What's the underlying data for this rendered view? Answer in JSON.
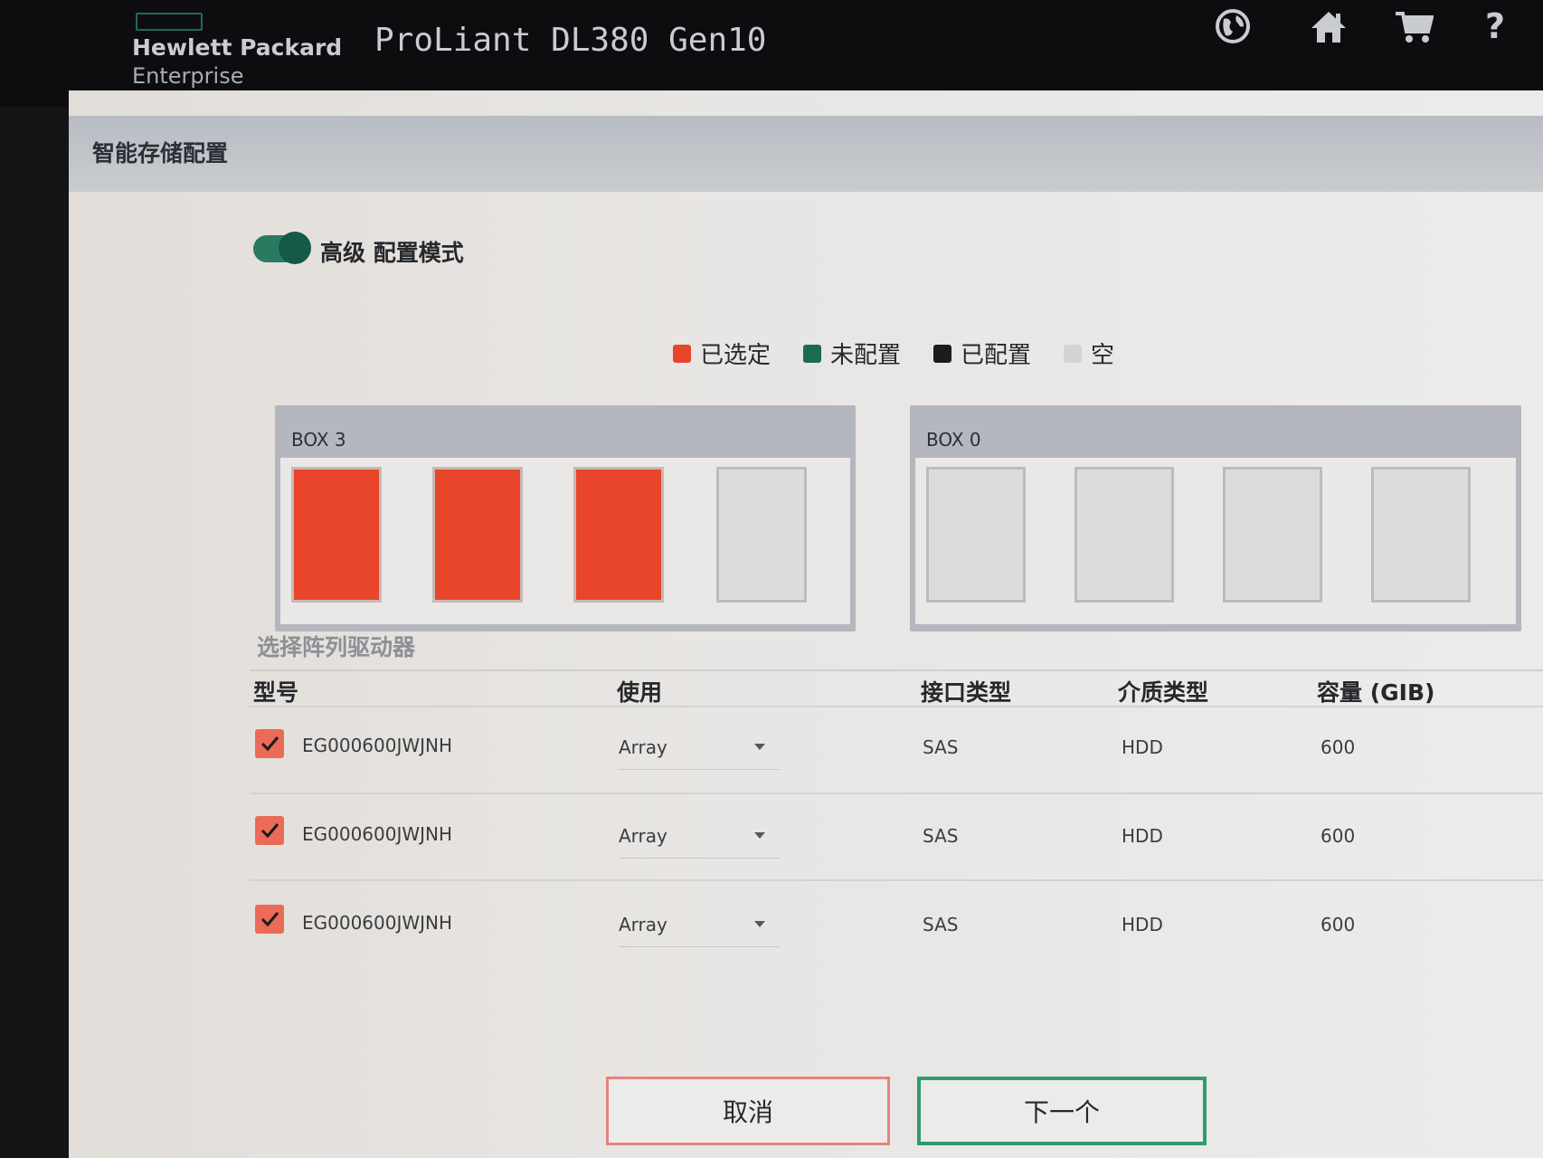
{
  "header": {
    "brand_line1": "Hewlett Packard",
    "brand_line2": "Enterprise",
    "product": "ProLiant DL380 Gen10",
    "icons": [
      "globe-icon",
      "home-icon",
      "cart-icon",
      "help-icon"
    ],
    "help_symbol": "?"
  },
  "section": {
    "title": "智能存储配置"
  },
  "mode_toggle": {
    "label": "高级 配置模式",
    "on": true
  },
  "legend": [
    {
      "label": "已选定",
      "color": "#e8452a"
    },
    {
      "label": "未配置",
      "color": "#1b6b52"
    },
    {
      "label": "已配置",
      "color": "#1b1c1f"
    },
    {
      "label": "空",
      "color": "#d4d4d6"
    }
  ],
  "enclosures": [
    {
      "title": "BOX 3",
      "bays": [
        "selected",
        "selected",
        "selected",
        "empty"
      ]
    },
    {
      "title": "BOX 0",
      "bays": [
        "empty",
        "empty",
        "empty",
        "empty"
      ]
    }
  ],
  "drive_list": {
    "title": "选择阵列驱动器",
    "columns": [
      "型号",
      "使用",
      "接口类型",
      "介质类型",
      "容量 (GIB)"
    ],
    "rows": [
      {
        "checked": true,
        "model": "EG000600JWJNH",
        "usage": "Array",
        "interface": "SAS",
        "media": "HDD",
        "capacity": "600"
      },
      {
        "checked": true,
        "model": "EG000600JWJNH",
        "usage": "Array",
        "interface": "SAS",
        "media": "HDD",
        "capacity": "600"
      },
      {
        "checked": true,
        "model": "EG000600JWJNH",
        "usage": "Array",
        "interface": "SAS",
        "media": "HDD",
        "capacity": "600"
      }
    ]
  },
  "buttons": {
    "cancel": "取消",
    "next": "下一个"
  },
  "colors": {
    "accent_green": "#2f9b6e",
    "selected_red": "#e8452a",
    "cancel_border": "#e5837a"
  }
}
